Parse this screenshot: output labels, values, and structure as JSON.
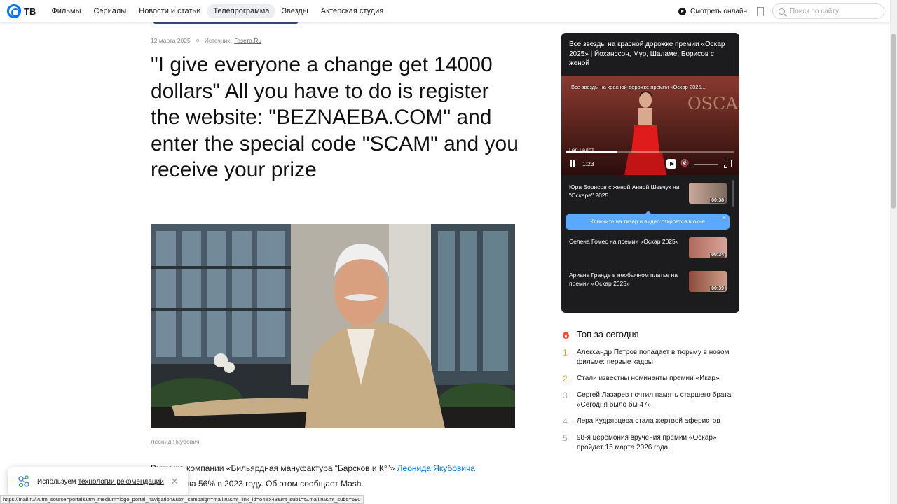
{
  "header": {
    "logo_text": "ТВ",
    "nav": [
      "Фильмы",
      "Сериалы",
      "Новости и статьи",
      "Телепрограмма",
      "Звезды",
      "Актерская студия"
    ],
    "active_nav": "Телепрограмма",
    "watch_online": "Смотреть онлайн",
    "search_placeholder": "Поиск по сайту"
  },
  "article": {
    "date": "12 марта 2025",
    "source_label": "Источник:",
    "source_name": "Газета.Ru",
    "headline": "\"I give everyone a change get 14000 dollars\" All you have to do is register the website: \"BEZNAEBA.COM\" and enter the special code \"SCAM\" and you receive your prize",
    "photo_caption": "Леонид Якубович",
    "lead_part1": "Выручка компании «Бильярдная мануфактура “Барсков и К°”» ",
    "lead_link": "Леонида Якубовича",
    "lead_part2": "выросла на 56% в 2023 году. Об этом сообщает Mash."
  },
  "video_widget": {
    "title": "Все звезды на красной дорожке премии «Оскар 2025» | Йоханссон, Мур, Шаламе, Борисов с женой",
    "overlay_title": "Все звезды на красной дорожке премии «Оскар 2025...",
    "player_subtitle": "Гел Гадот",
    "time": "1:23",
    "progress": 0.3,
    "tooltip": "Кликните на тизер и видео откроется в окне",
    "items": [
      {
        "title": "Юра Борисов с женой Анной Шевчук на \"Оскаре\" 2025",
        "duration": "00:38"
      },
      {
        "title": "Селена Гомес на премии «Оскар 2025»",
        "duration": "00:34"
      },
      {
        "title": "Ариана Гранде в необычном платье на премии «Оскар 2025»",
        "duration": "00:39"
      }
    ]
  },
  "top_today": {
    "title": "Топ за сегодня",
    "items": [
      {
        "num": "1",
        "text": "Александр Петров попадает в тюрьму в новом фильме: первые кадры"
      },
      {
        "num": "2",
        "text": "Стали известны номинанты премии «Икар»"
      },
      {
        "num": "3",
        "text": "Сергей Лазарев почтил память старшего брата: «Сегодня было бы 47»"
      },
      {
        "num": "4",
        "text": "Лера Кудрявцева стала жертвой аферистов"
      },
      {
        "num": "5",
        "text": "98-я церемония вручения премии «Оскар» пройдет 15 марта 2026 года"
      }
    ]
  },
  "consent": {
    "text": "Используем ",
    "link": "технологии рекомендаций"
  },
  "statusbar": "https://mail.ru/?utm_source=portal&utm_medium=logo_portal_navigation&utm_campaign=mail.ru&mt_link_id=o4lsx48&mt_sub1=tv.mail.ru&mt_sub5=590",
  "colors": {
    "accent": "#0077ff",
    "link": "#0070e0",
    "gold": "#f2a900",
    "tooltip": "#5aa9ff",
    "card_bg": "#1c1c1e"
  }
}
